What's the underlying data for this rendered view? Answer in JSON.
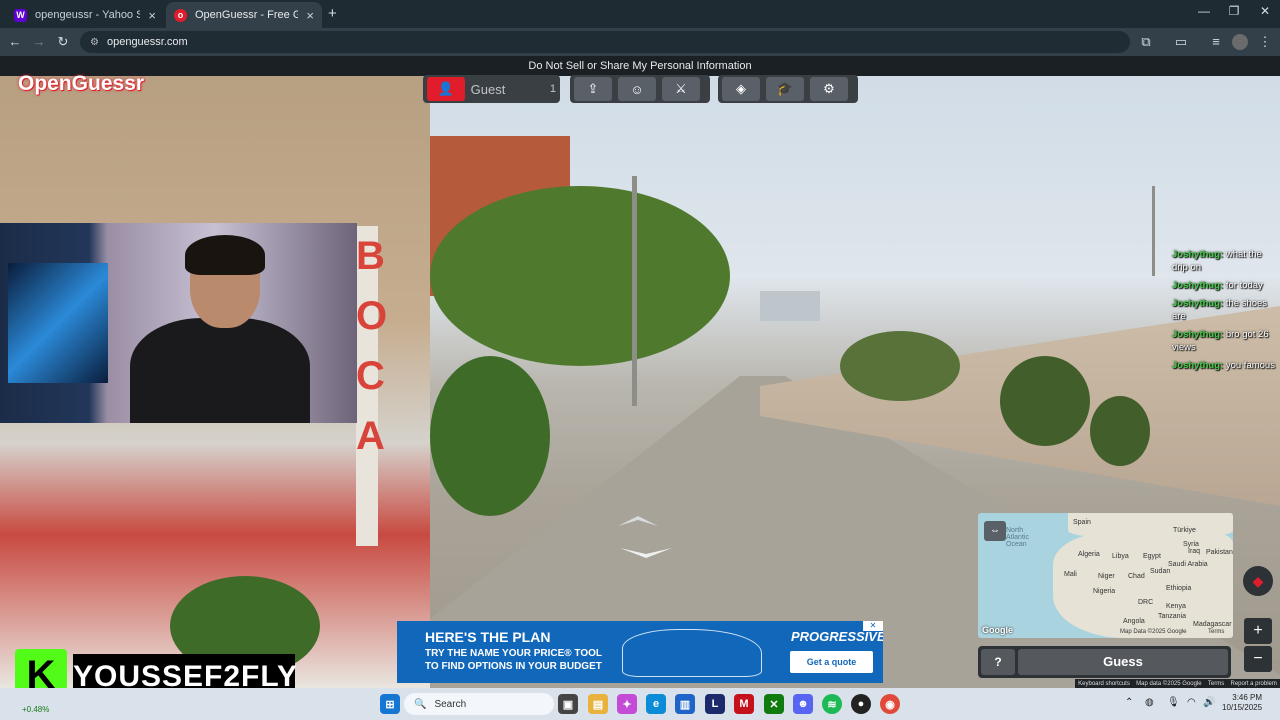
{
  "browser": {
    "tabs": [
      {
        "title": "opengeussr - Yahoo Search Re",
        "favicon": "yahoo-icon",
        "active": false
      },
      {
        "title": "OpenGuessr - Free GeoGuessr A",
        "favicon": "openguessr-icon",
        "active": true
      }
    ],
    "new_tab": "+",
    "url": "openguessr.com"
  },
  "page": {
    "notice": "Do Not Sell or Share My Personal Information",
    "logo": "OpenGuessr",
    "toolbar": {
      "player_name": "Guest",
      "player_count": "1"
    },
    "building_text": "BOCA",
    "chat": [
      {
        "user": "Joshythug:",
        "text": "what the drip on"
      },
      {
        "user": "Joshythug:",
        "text": "for today"
      },
      {
        "user": "Joshythug:",
        "text": "the shoes are"
      },
      {
        "user": "Joshythug:",
        "text": "bro got 26 views"
      },
      {
        "user": "Joshythug:",
        "text": "you famous"
      }
    ],
    "minimap": {
      "labels": [
        "Spain",
        "Türkiye",
        "North Atlantic Ocean",
        "Algeria",
        "Libya",
        "Egypt",
        "Syria",
        "Iraq",
        "Pakistan",
        "Mali",
        "Niger",
        "Chad",
        "Sudan",
        "Saudi Arabia",
        "Nigeria",
        "Ethiopia",
        "DRC",
        "Kenya",
        "Tanzania",
        "Angola",
        "Madagascar"
      ],
      "attribution": "Map Data ©2025 Google",
      "terms": "Terms"
    },
    "guess": {
      "help": "?",
      "button": "Guess"
    },
    "attribution": [
      "Keyboard shortcuts",
      "Map data ©2025 Google",
      "Terms",
      "Report a problem"
    ]
  },
  "ad": {
    "headline": "HERE'S THE PLAN",
    "line1": "TRY THE NAME YOUR PRICE® TOOL",
    "line2": "TO FIND OPTIONS IN YOUR BUDGET",
    "brand": "PROGRESSIVE",
    "cta": "Get a quote"
  },
  "streamer": {
    "logo_letter": "K",
    "name": "YOUSSEF2FLY"
  },
  "taskbar": {
    "search": "Search",
    "time": "3:46 PM",
    "date": "10/15/2025",
    "stock": "+0.48%"
  },
  "colors": {
    "accent": "#e11d2b",
    "kick_green": "#53fc18",
    "ad_blue": "#1167b9",
    "chat_user": "#48c94b"
  }
}
